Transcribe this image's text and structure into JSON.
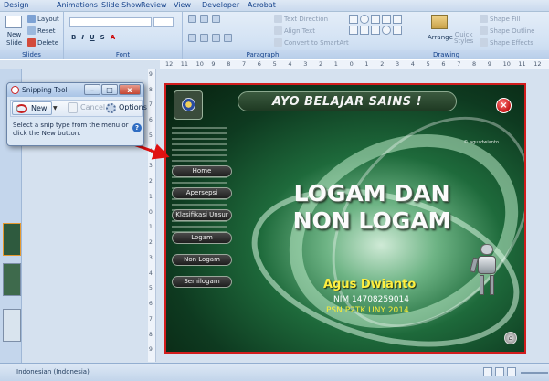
{
  "menubar": {
    "tabs": [
      "Design",
      "Animations",
      "Slide Show",
      "Review",
      "View",
      "Developer",
      "Acrobat"
    ]
  },
  "ribbon": {
    "slides_group": {
      "new_slide_label": "New",
      "new_slide_sub": "Slide",
      "layout_label": "Layout",
      "reset_label": "Reset",
      "delete_label": "Delete",
      "group_label": "Slides"
    },
    "font_group": {
      "group_label": "Font"
    },
    "paragraph_group": {
      "text_direction": "Text Direction",
      "align_text": "Align Text",
      "convert_smartart": "Convert to SmartArt",
      "group_label": "Paragraph"
    },
    "drawing_group": {
      "arrange_label": "Arrange",
      "quick_styles_label": "Quick",
      "quick_styles_sub": "Styles",
      "shape_fill": "Shape Fill",
      "shape_outline": "Shape Outline",
      "shape_effects": "Shape Effects",
      "group_label": "Drawing"
    }
  },
  "ruler": {
    "ticks": [
      "12",
      "11",
      "10",
      "9",
      "8",
      "7",
      "6",
      "5",
      "4",
      "3",
      "2",
      "1",
      "0",
      "1",
      "2",
      "3",
      "4",
      "5",
      "6",
      "7",
      "8",
      "9",
      "10",
      "11",
      "12"
    ],
    "vticks": [
      "9",
      "8",
      "7",
      "6",
      "5",
      "4",
      "3",
      "2",
      "1",
      "0",
      "1",
      "2",
      "3",
      "4",
      "5",
      "6",
      "7",
      "8",
      "9"
    ]
  },
  "snipping_tool": {
    "title": "Snipping Tool",
    "new_label": "New",
    "cancel_label": "Cancel",
    "options_label": "Options",
    "message": "Select a snip type from the menu or click the New button.",
    "help": "?",
    "minimize": "–",
    "maximize": "□",
    "close": "x"
  },
  "slide": {
    "header_title": "AYO BELAJAR SAINS !",
    "watermark": "© agusdwianto",
    "close_symbol": "×",
    "nav_items": [
      "Home",
      "Apersepsi",
      "Klasifikasi Unsur",
      "Logam",
      "Non Logam",
      "Semilogam"
    ],
    "main_title_line1": "LOGAM DAN",
    "main_title_line2": "NON LOGAM",
    "author": "Agus Dwianto",
    "nim": "NIM  14708259014",
    "org": "PSN P2TK UNY 2014",
    "home_symbol": "⌂"
  },
  "statusbar": {
    "language": "Indonesian (Indonesia)"
  },
  "colors": {
    "accent_red": "#d21d1d",
    "ribbon_blue": "#c9d9ee",
    "title_yellow": "#ffef3f"
  }
}
